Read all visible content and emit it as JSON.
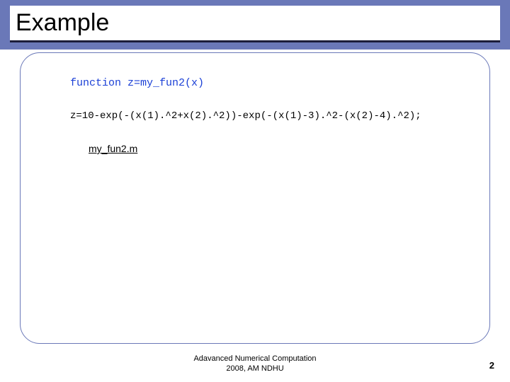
{
  "slide": {
    "title": "Example"
  },
  "code": {
    "line1": "function z=my_fun2(x)",
    "line2": "z=10-exp(-(x(1).^2+x(2).^2))-exp(-(x(1)-3).^2-(x(2)-4).^2);"
  },
  "link": {
    "filename": "my_fun2.m"
  },
  "footer": {
    "line1": "Adavanced Numerical Computation",
    "line2": "2008, AM NDHU"
  },
  "page": {
    "number": "2"
  }
}
